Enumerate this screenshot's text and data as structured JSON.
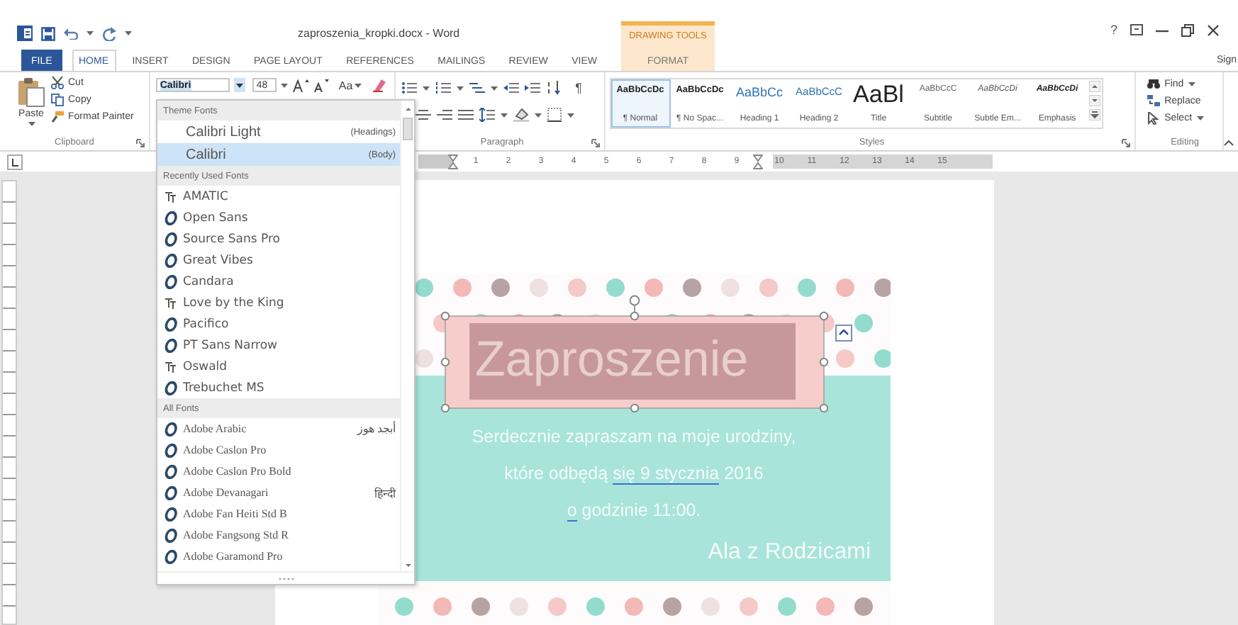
{
  "title_bar": {
    "title": "zaproszenia_kropki.docx - Word",
    "context_group": "DRAWING TOOLS",
    "help": "?"
  },
  "tabs": [
    {
      "label": "FILE",
      "kind": "file",
      "selected": false
    },
    {
      "label": "HOME",
      "kind": "tab",
      "selected": true
    },
    {
      "label": "INSERT",
      "kind": "tab",
      "selected": false
    },
    {
      "label": "DESIGN",
      "kind": "tab",
      "selected": false
    },
    {
      "label": "PAGE LAYOUT",
      "kind": "tab",
      "selected": false
    },
    {
      "label": "REFERENCES",
      "kind": "tab",
      "selected": false
    },
    {
      "label": "MAILINGS",
      "kind": "tab",
      "selected": false
    },
    {
      "label": "REVIEW",
      "kind": "tab",
      "selected": false
    },
    {
      "label": "VIEW",
      "kind": "tab",
      "selected": false
    },
    {
      "label": "FORMAT",
      "kind": "context",
      "selected": false
    }
  ],
  "account": "Sign",
  "clipboard": {
    "paste": "Paste",
    "cut": "Cut",
    "copy": "Copy",
    "format_painter": "Format Painter",
    "label": "Clipboard"
  },
  "font": {
    "name": "Calibri",
    "size": "48",
    "case": "Aa"
  },
  "paragraph": {
    "label": "Paragraph",
    "mark": "¶"
  },
  "styles": {
    "label": "Styles",
    "items": [
      {
        "preview": "AaBbCcDc",
        "name": "¶ Normal",
        "kind": "normal",
        "selected": true
      },
      {
        "preview": "AaBbCcDc",
        "name": "¶ No Spac...",
        "kind": "normal",
        "selected": false
      },
      {
        "preview": "AaBbCc",
        "name": "Heading 1",
        "kind": "heading1",
        "selected": false
      },
      {
        "preview": "AaBbCcC",
        "name": "Heading 2",
        "kind": "heading2",
        "selected": false
      },
      {
        "preview": "AaBl",
        "name": "Title",
        "kind": "title",
        "selected": false
      },
      {
        "preview": "AaBbCcC",
        "name": "Subtitle",
        "kind": "subtitle",
        "selected": false
      },
      {
        "preview": "AaBbCcDi",
        "name": "Subtle Em...",
        "kind": "subtle",
        "selected": false
      },
      {
        "preview": "AaBbCcDi",
        "name": "Emphasis",
        "kind": "emphasis",
        "selected": false
      }
    ]
  },
  "editing": {
    "label": "Editing",
    "items": [
      {
        "label": "Find",
        "kind": "menu"
      },
      {
        "label": "Replace",
        "kind": "button"
      },
      {
        "label": "Select",
        "kind": "menu"
      }
    ]
  },
  "ruler": {
    "numbers": [
      "1",
      "2",
      "3",
      "4",
      "5",
      "6",
      "7",
      "8",
      "9",
      "10",
      "11",
      "12",
      "13",
      "14",
      "15"
    ]
  },
  "font_menu": {
    "sections": [
      {
        "title": "Theme Fonts",
        "kind": "theme",
        "items": [
          {
            "name": "Calibri Light",
            "role": "(Headings)",
            "selected": false
          },
          {
            "name": "Calibri",
            "role": "(Body)",
            "selected": true
          }
        ]
      },
      {
        "title": "Recently Used Fonts",
        "kind": "list",
        "items": [
          {
            "name": "AMATIC",
            "kind": "truetype",
            "selected": false
          },
          {
            "name": "Open Sans",
            "kind": "opentype",
            "selected": false
          },
          {
            "name": "Source Sans Pro",
            "kind": "opentype",
            "selected": false
          },
          {
            "name": "Great Vibes",
            "kind": "opentype",
            "selected": false
          },
          {
            "name": "Candara",
            "kind": "opentype",
            "selected": false
          },
          {
            "name": "Love by the King",
            "kind": "truetype",
            "selected": false
          },
          {
            "name": "Pacifico",
            "kind": "opentype",
            "selected": false
          },
          {
            "name": "PT Sans Narrow",
            "kind": "opentype",
            "selected": false
          },
          {
            "name": "Oswald",
            "kind": "truetype",
            "selected": false
          },
          {
            "name": "Trebuchet MS",
            "kind": "opentype",
            "selected": false
          }
        ]
      },
      {
        "title": "All Fonts",
        "kind": "list",
        "items": [
          {
            "name": "Adobe Arabic",
            "kind": "opentype",
            "sample": "أبجد هوز",
            "selected": false
          },
          {
            "name": "Adobe Caslon Pro",
            "kind": "opentype",
            "selected": false
          },
          {
            "name": "Adobe Caslon Pro Bold",
            "kind": "opentype",
            "selected": false
          },
          {
            "name": "Adobe Devanagari",
            "kind": "opentype",
            "sample": "हिन्दी",
            "selected": false
          },
          {
            "name": "Adobe Fan Heiti Std B",
            "kind": "opentype",
            "selected": false
          },
          {
            "name": "Adobe Fangsong Std R",
            "kind": "opentype",
            "selected": false
          },
          {
            "name": "Adobe Garamond Pro",
            "kind": "opentype",
            "selected": false
          }
        ]
      }
    ]
  },
  "document": {
    "title": "Zaproszenie",
    "lines": [
      {
        "segments": [
          {
            "text": "Serdecznie zapraszam na moje urodziny,",
            "marked": false
          }
        ]
      },
      {
        "segments": [
          {
            "text": "które odbędą ",
            "marked": false
          },
          {
            "text": "się  9 stycznia",
            "marked": true
          },
          {
            "text": " 2016",
            "marked": false
          }
        ]
      },
      {
        "segments": [
          {
            "text": "o",
            "marked": true
          },
          {
            "text": " godzinie 11:00.",
            "marked": false
          }
        ]
      }
    ],
    "signature": "Ala z Rodzicami"
  }
}
